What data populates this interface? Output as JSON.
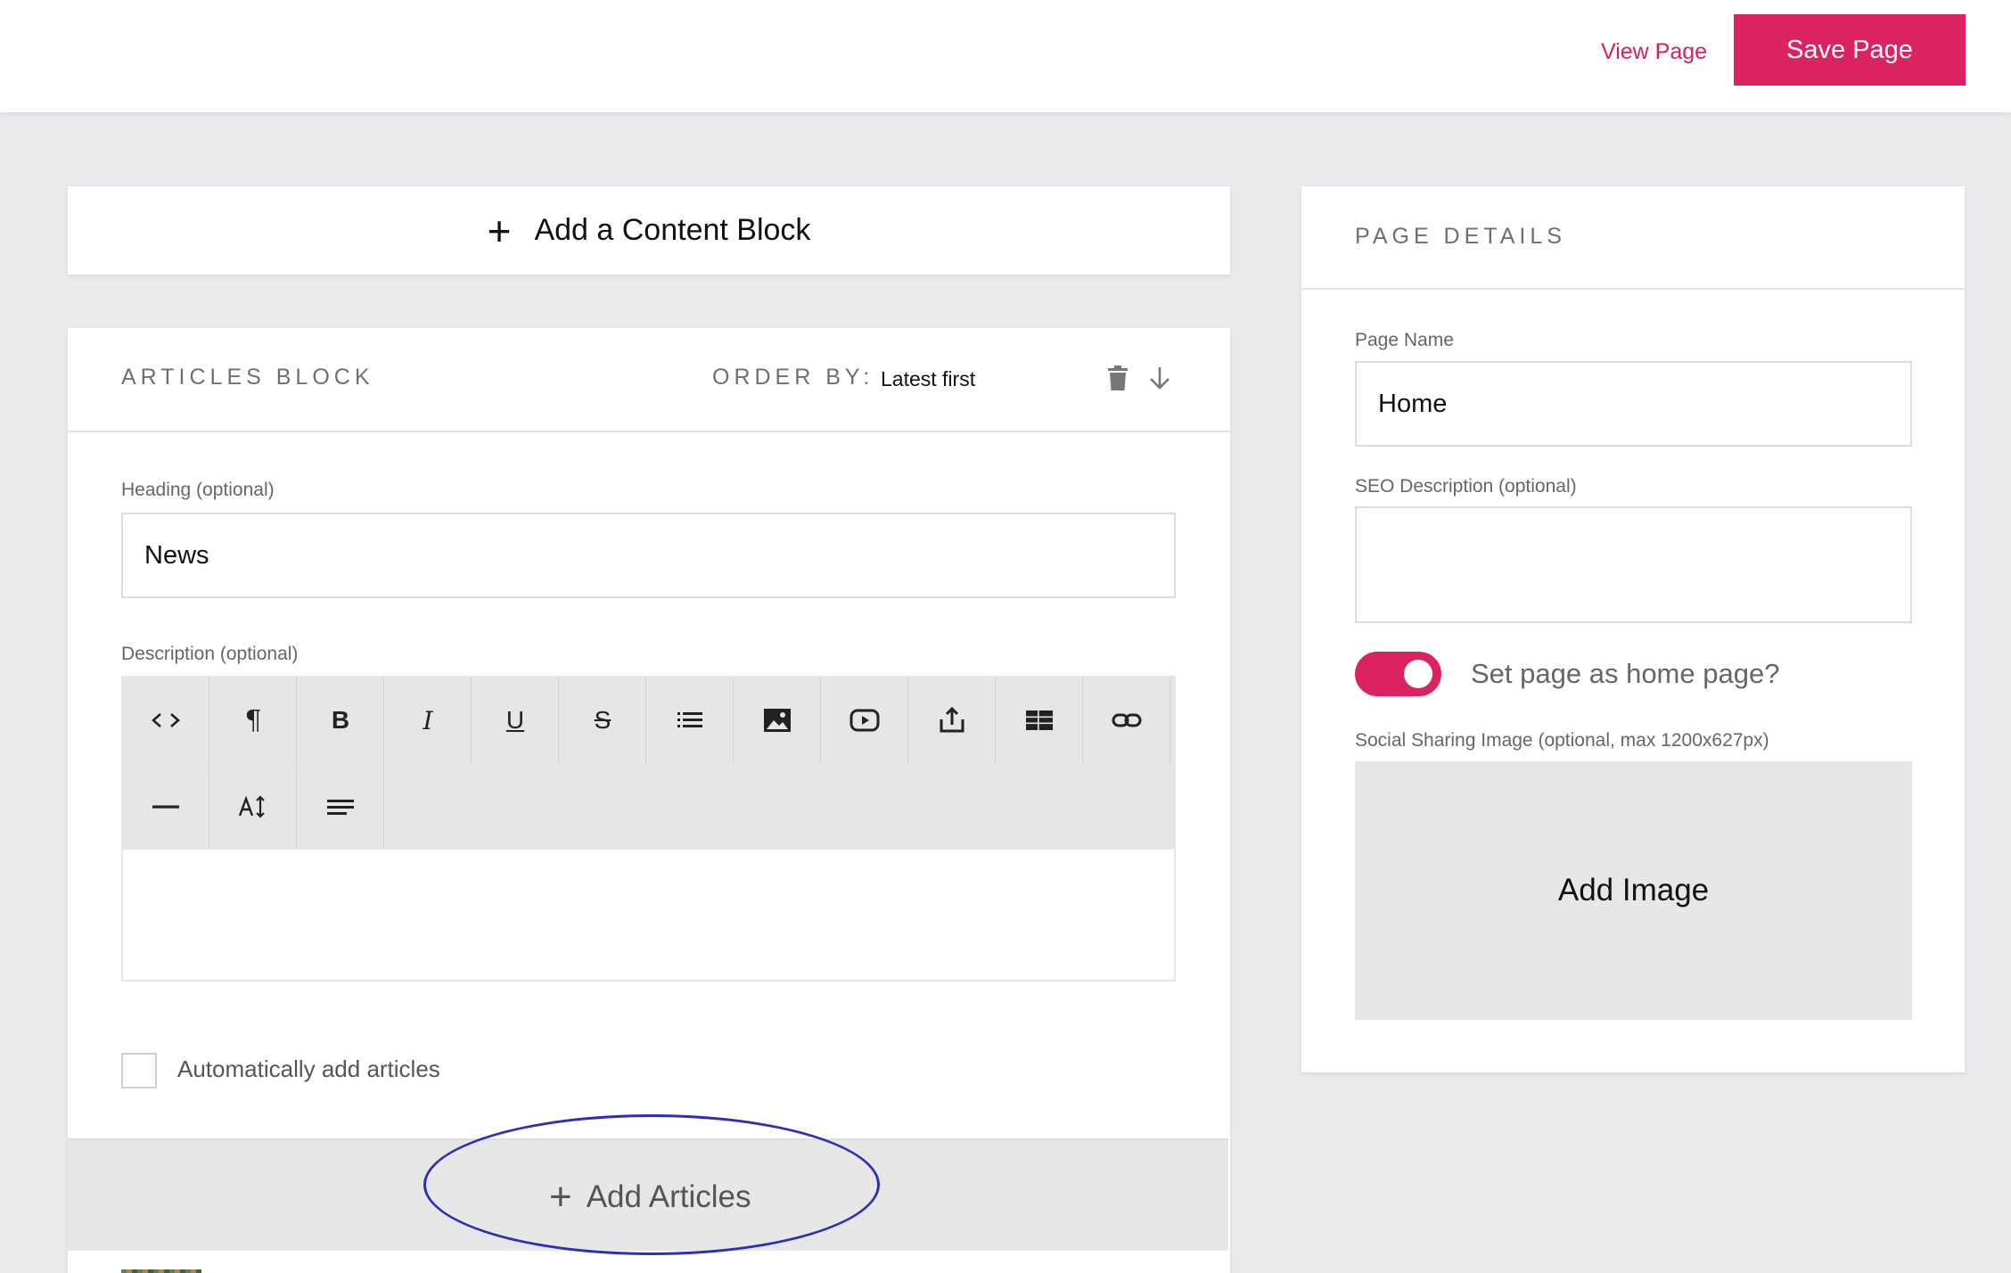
{
  "topbar": {
    "view_label": "View Page",
    "save_label": "Save Page"
  },
  "add_block": {
    "label": "Add a Content Block",
    "icon": "plus-icon"
  },
  "articles_block": {
    "title": "ARTICLES BLOCK",
    "order_by_label": "ORDER BY:",
    "order_by_value": "Latest first",
    "heading_label": "Heading (optional)",
    "heading_value": "News",
    "description_label": "Description (optional)",
    "toolbar": {
      "row1": [
        "code-view",
        "paragraph",
        "bold",
        "italic",
        "underline",
        "strikethrough",
        "unordered-list",
        "image",
        "video",
        "upload",
        "table",
        "link"
      ],
      "row2": [
        "horizontal-rule",
        "font-size",
        "align-left"
      ],
      "bold_glyph": "B",
      "italic_glyph": "I",
      "underline_glyph": "U",
      "strike_glyph": "S",
      "paragraph_glyph": "¶"
    },
    "auto_add_label": "Automatically add articles",
    "add_articles_label": "Add Articles"
  },
  "page_details": {
    "title": "PAGE DETAILS",
    "page_name_label": "Page Name",
    "page_name_value": "Home",
    "seo_label": "SEO Description (optional)",
    "seo_value": "",
    "home_toggle_label": "Set page as home page?",
    "home_toggle_on": true,
    "social_label": "Social Sharing Image (optional, max 1200x627px)",
    "add_image_label": "Add Image"
  },
  "colors": {
    "accent": "#dc2361",
    "background": "#ebebee",
    "annotation": "#2d2fb6"
  }
}
